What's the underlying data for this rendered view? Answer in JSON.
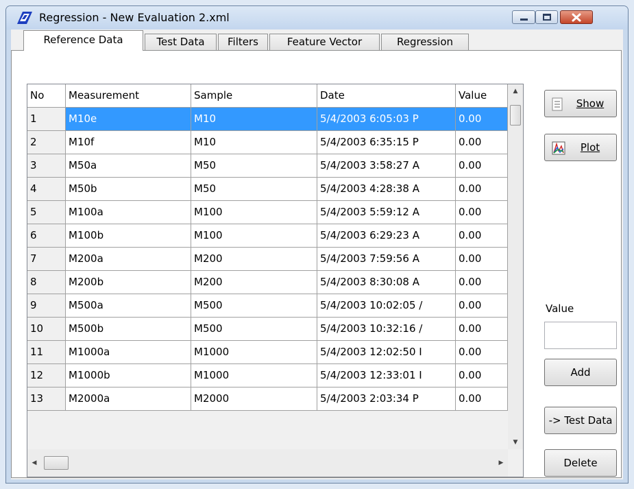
{
  "window": {
    "title": "Regression - New Evaluation 2.xml"
  },
  "tabs": [
    {
      "label": "Reference Data",
      "active": true
    },
    {
      "label": "Test Data",
      "active": false
    },
    {
      "label": "Filters",
      "active": false
    },
    {
      "label": "Feature Vector",
      "active": false
    },
    {
      "label": "Regression",
      "active": false
    }
  ],
  "table": {
    "columns": [
      "No",
      "Measurement",
      "Sample",
      "Date",
      "Value"
    ],
    "rows": [
      {
        "no": "1",
        "measurement": "M10e",
        "sample": "M10",
        "date": "5/4/2003 6:05:03 P",
        "value": "0.00",
        "selected": true
      },
      {
        "no": "2",
        "measurement": "M10f",
        "sample": "M10",
        "date": "5/4/2003 6:35:15 P",
        "value": "0.00"
      },
      {
        "no": "3",
        "measurement": "M50a",
        "sample": "M50",
        "date": "5/4/2003 3:58:27 A",
        "value": "0.00"
      },
      {
        "no": "4",
        "measurement": "M50b",
        "sample": "M50",
        "date": "5/4/2003 4:28:38 A",
        "value": "0.00"
      },
      {
        "no": "5",
        "measurement": "M100a",
        "sample": "M100",
        "date": "5/4/2003 5:59:12 A",
        "value": "0.00"
      },
      {
        "no": "6",
        "measurement": "M100b",
        "sample": "M100",
        "date": "5/4/2003 6:29:23 A",
        "value": "0.00"
      },
      {
        "no": "7",
        "measurement": "M200a",
        "sample": "M200",
        "date": "5/4/2003 7:59:56 A",
        "value": "0.00"
      },
      {
        "no": "8",
        "measurement": "M200b",
        "sample": "M200",
        "date": "5/4/2003 8:30:08 A",
        "value": "0.00"
      },
      {
        "no": "9",
        "measurement": "M500a",
        "sample": "M500",
        "date": "5/4/2003 10:02:05 /",
        "value": "0.00"
      },
      {
        "no": "10",
        "measurement": "M500b",
        "sample": "M500",
        "date": "5/4/2003 10:32:16 /",
        "value": "0.00"
      },
      {
        "no": "11",
        "measurement": "M1000a",
        "sample": "M1000",
        "date": "5/4/2003 12:02:50 I",
        "value": "0.00"
      },
      {
        "no": "12",
        "measurement": "M1000b",
        "sample": "M1000",
        "date": "5/4/2003 12:33:01 I",
        "value": "0.00"
      },
      {
        "no": "13",
        "measurement": "M2000a",
        "sample": "M2000",
        "date": "5/4/2003 2:03:34 P",
        "value": "0.00"
      }
    ]
  },
  "buttons": {
    "show": "Show",
    "plot": "Plot",
    "add": "Add",
    "to_test_data": "-> Test Data",
    "delete": "Delete"
  },
  "value_field": {
    "label": "Value",
    "value": ""
  },
  "colors": {
    "selection": "#3399ff",
    "close_button": "#c4462a"
  }
}
